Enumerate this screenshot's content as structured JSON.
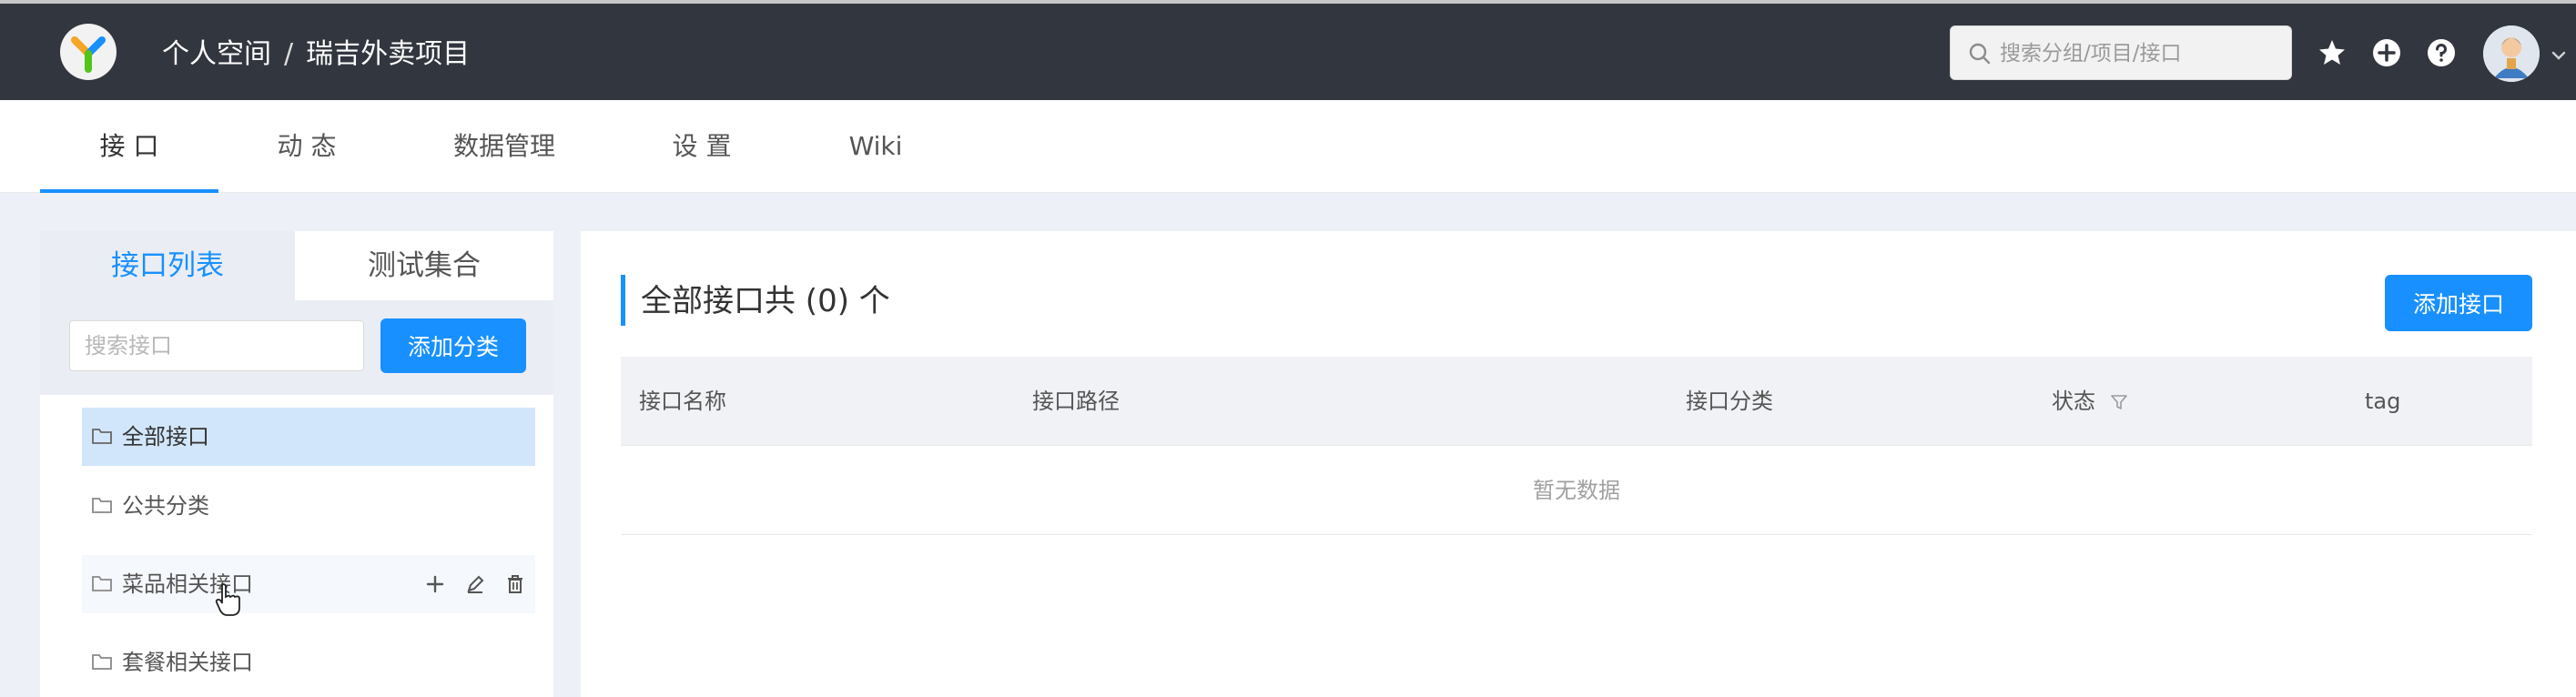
{
  "header": {
    "breadcrumb": [
      "个人空间",
      "瑞吉外卖项目"
    ],
    "separator": "/",
    "search_placeholder": "搜索分组/项目/接口",
    "icons": [
      "star-icon",
      "add-circle-icon",
      "help-icon"
    ]
  },
  "nav": {
    "tabs": [
      {
        "label": "接 口"
      },
      {
        "label": "动 态"
      },
      {
        "label": "数据管理"
      },
      {
        "label": "设 置"
      },
      {
        "label": "Wiki"
      }
    ],
    "active_index": 0
  },
  "sidebar": {
    "tabs": [
      "接口列表",
      "测试集合"
    ],
    "search_placeholder": "搜索接口",
    "add_category_label": "添加分类",
    "items": [
      {
        "label": "全部接口",
        "selected": true
      },
      {
        "label": "公共分类"
      },
      {
        "label": "菜品相关接口",
        "hovered": true
      },
      {
        "label": "套餐相关接口"
      }
    ]
  },
  "main": {
    "title": "全部接口共 (0) 个",
    "add_button_label": "添加接口",
    "columns": [
      "接口名称",
      "接口路径",
      "接口分类",
      "状态",
      "tag"
    ],
    "empty_text": "暂无数据"
  },
  "colors": {
    "header_bg": "#32363f",
    "accent": "#1890ff",
    "selected_bg": "#d2e6fb"
  }
}
